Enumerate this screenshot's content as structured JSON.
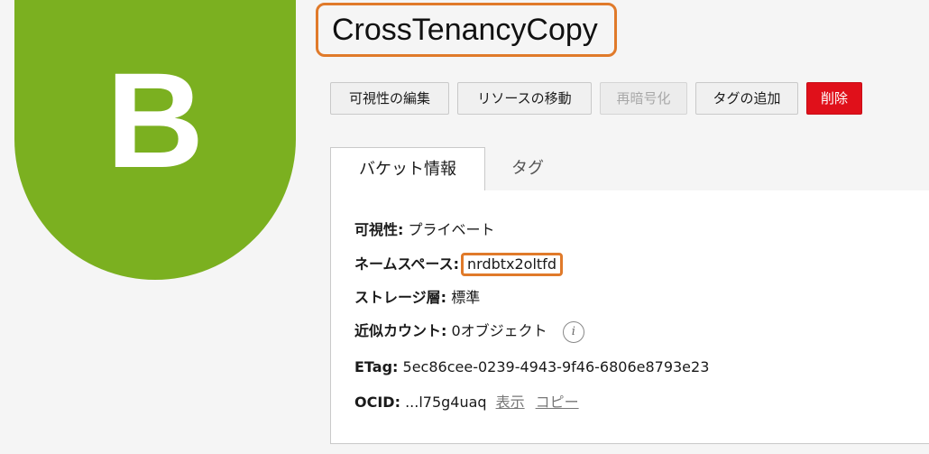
{
  "badge": {
    "letter": "B",
    "color": "#7bb020"
  },
  "bucket": {
    "name": "CrossTenancyCopy"
  },
  "actions": {
    "edit_visibility": "可視性の編集",
    "move_resource": "リソースの移動",
    "reencrypt": "再暗号化",
    "add_tags": "タグの追加",
    "delete": "削除"
  },
  "tabs": {
    "bucket_info": "バケット情報",
    "tags": "タグ"
  },
  "details": {
    "visibility": {
      "label": "可視性:",
      "value": "プライベート"
    },
    "namespace": {
      "label": "ネームスペース:",
      "value": "nrdbtx2oltfd"
    },
    "storage_tier": {
      "label": "ストレージ層:",
      "value": "標準"
    },
    "approx_count": {
      "label": "近似カウント:",
      "value": "0オブジェクト"
    },
    "etag": {
      "label": "ETag:",
      "value": "5ec86cee-0239-4943-9f46-6806e8793e23"
    },
    "ocid": {
      "label": "OCID:",
      "value": "...l75g4uaq",
      "show_link": "表示",
      "copy_link": "コピー"
    }
  },
  "icons": {
    "info": "info-icon",
    "info_glyph": "i"
  },
  "colors": {
    "accent": "#e07a2a",
    "danger": "#e0101a"
  }
}
